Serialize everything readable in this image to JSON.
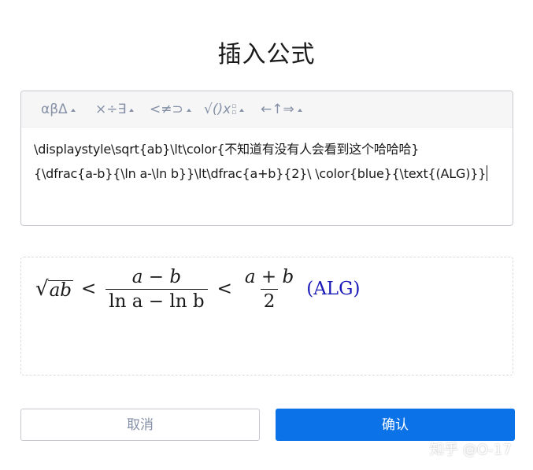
{
  "dialog": {
    "title": "插入公式"
  },
  "toolbar": {
    "groups": [
      {
        "label": "αβΔ",
        "icon": "greek-letters-icon"
      },
      {
        "label": "×÷∃",
        "icon": "operators-icon"
      },
      {
        "label": "<≠⊃",
        "icon": "relations-icon"
      },
      {
        "label": "√()x",
        "icon": "functions-icon"
      },
      {
        "label": "←↑⇒",
        "icon": "arrows-icon"
      }
    ]
  },
  "editor": {
    "latex_line1": "\\displaystyle\\sqrt{ab}\\lt\\color{不知道有没有人会看到这个哈哈哈}",
    "latex_line2": "{\\dfrac{a-b}{\\ln a-\\ln b}}\\lt\\dfrac{a+b}{2}\\ \\color{blue}{\\text{(ALG)}}"
  },
  "preview": {
    "sqrt_radicand": "ab",
    "lt1": "<",
    "frac1_num": "a − b",
    "frac1_den": "ln a − ln b",
    "lt2": "<",
    "frac2_num": "a + b",
    "frac2_den": "2",
    "colored_text": "(ALG)",
    "colored_text_color": "#1a1ab8"
  },
  "buttons": {
    "cancel": "取消",
    "confirm": "确认",
    "confirm_color": "#0b72e7"
  },
  "watermark": "知乎 @O-17"
}
